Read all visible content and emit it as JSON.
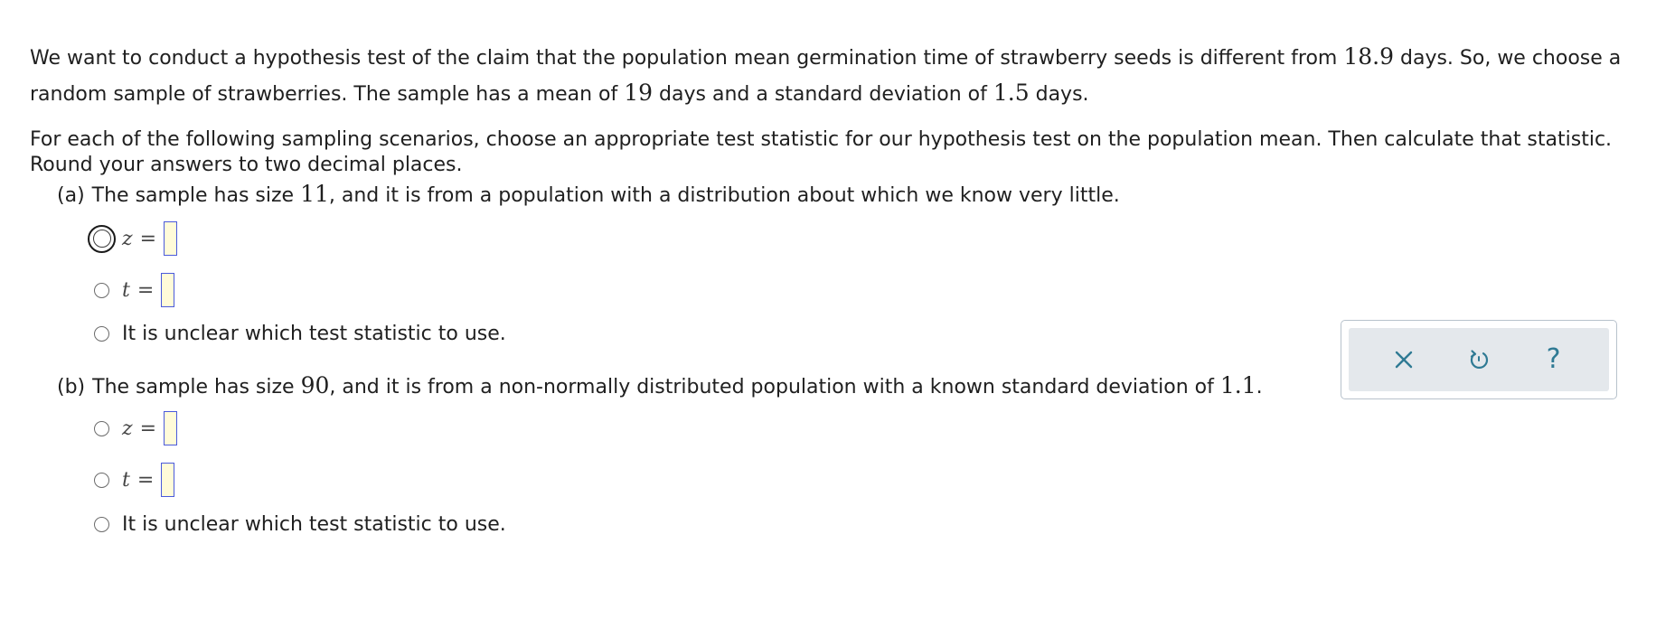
{
  "intro": {
    "text1": "We want to conduct a hypothesis test of the claim that the population mean germination time of strawberry seeds is different from ",
    "claim_value": "18.9",
    "text2": " days. So, we choose a random sample of strawberries. The sample has a mean of ",
    "sample_mean": "19",
    "text3": " days and a standard deviation of ",
    "sample_sd": "1.5",
    "text4": " days."
  },
  "instructions": "For each of the following sampling scenarios, choose an appropriate test statistic for our hypothesis test on the population mean. Then calculate that statistic. Round your answers to two decimal places.",
  "parts": [
    {
      "label": "(a)",
      "text1": "The sample has size ",
      "size": "11",
      "text2": ", and it is from a population with a distribution about which we know very little.",
      "text3": "",
      "options": [
        {
          "var": "z",
          "eq": "=",
          "value": ""
        },
        {
          "var": "t",
          "eq": "=",
          "value": ""
        },
        {
          "text": "It is unclear which test statistic to use."
        }
      ]
    },
    {
      "label": "(b)",
      "text1": "The sample has size ",
      "size": "90",
      "text2": ", and it is from a non-normally distributed population with a known standard deviation of ",
      "sd": "1.1",
      "text3": ".",
      "options": [
        {
          "var": "z",
          "eq": "=",
          "value": ""
        },
        {
          "var": "t",
          "eq": "=",
          "value": ""
        },
        {
          "text": "It is unclear which test statistic to use."
        }
      ]
    }
  ],
  "toolbar": {
    "close_icon": "close-icon",
    "undo_icon": "undo-icon",
    "help_glyph": "?"
  },
  "colors": {
    "accent": "#2f7a94",
    "answer_box_border": "#4a5adb",
    "answer_box_fill": "#fffbd9",
    "toolbar_bg": "#e4e8ec"
  }
}
